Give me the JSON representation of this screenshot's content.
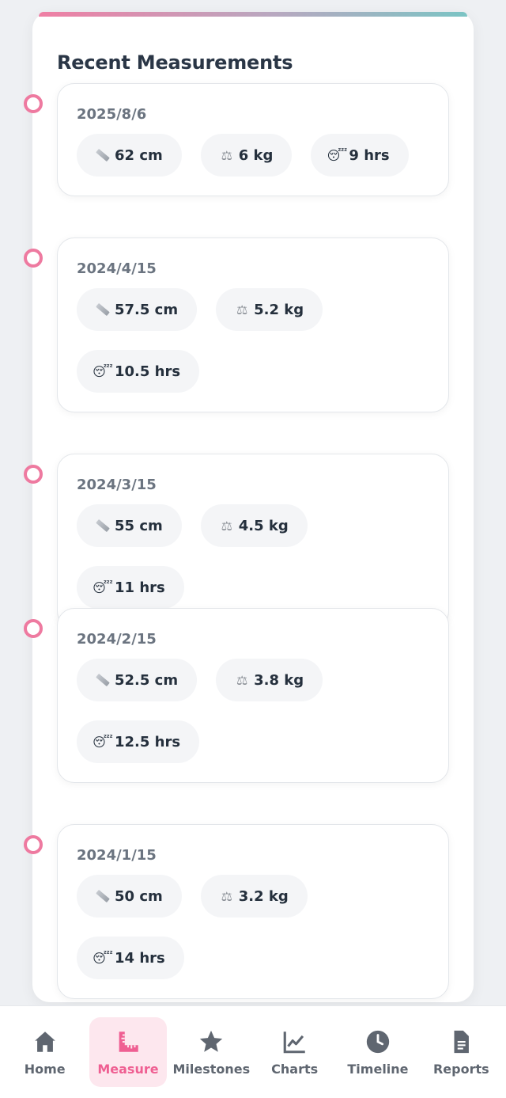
{
  "panel": {
    "title": "Recent Measurements"
  },
  "measurements": [
    {
      "date": "2025/8/6",
      "length": "62 cm",
      "weight": "6 kg",
      "sleep": "9 hrs"
    },
    {
      "date": "2024/4/15",
      "length": "57.5 cm",
      "weight": "5.2 kg",
      "sleep": "10.5 hrs"
    },
    {
      "date": "2024/3/15",
      "length": "55 cm",
      "weight": "4.5 kg",
      "sleep": "11 hrs"
    },
    {
      "date": "2024/2/15",
      "length": "52.5 cm",
      "weight": "3.8 kg",
      "sleep": "12.5 hrs"
    },
    {
      "date": "2024/1/15",
      "length": "50 cm",
      "weight": "3.2 kg",
      "sleep": "14 hrs"
    }
  ],
  "chip_icons": {
    "length": "ruler-icon",
    "weight": "balance-scale-icon",
    "sleep": "sleeping-face-icon"
  },
  "nav": {
    "items": [
      {
        "label": "Home",
        "icon": "home-icon",
        "active": false
      },
      {
        "label": "Measure",
        "icon": "ruler-icon",
        "active": true
      },
      {
        "label": "Milestones",
        "icon": "star-icon",
        "active": false
      },
      {
        "label": "Charts",
        "icon": "line-chart-icon",
        "active": false
      },
      {
        "label": "Timeline",
        "icon": "clock-icon",
        "active": false
      },
      {
        "label": "Reports",
        "icon": "document-icon",
        "active": false
      }
    ]
  },
  "colors": {
    "accent_pink": "#ef5f92",
    "timeline_dot": "#ee7aa0",
    "chip_bg": "#f4f5f7",
    "active_nav_bg": "#fde7ee"
  }
}
